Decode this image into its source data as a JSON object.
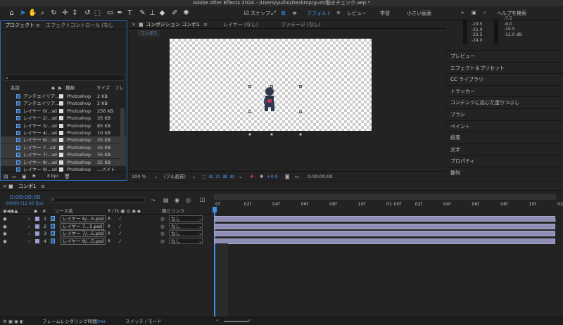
{
  "window_title": "Adobe After Effects 2024 - /Users/yuiho/Desktop/gust/動きチェック.aep *",
  "toolbar": {
    "snap_label": "スナップ",
    "workspaces": [
      "デフォルト",
      "レビュー",
      "学習",
      "小さい画面"
    ],
    "active_workspace": "デフォルト",
    "help_placeholder": "ヘルプを検索"
  },
  "project_panel": {
    "tabs": [
      "プロジェクト",
      "エフェクトコントロール (なし"
    ],
    "columns": {
      "name": "名前",
      "type": "種類",
      "size": "サイズ",
      "fr": "フレ"
    },
    "rows": [
      {
        "name": "アンチエイリア...",
        "type": "Photoshop",
        "size": "2 KB",
        "selected": false
      },
      {
        "name": "アンチエイリア...",
        "type": "Photoshop",
        "size": "2 KB",
        "selected": false
      },
      {
        "name": "レイヤー 0/...sd",
        "type": "Photoshop",
        "size": "256 KB",
        "selected": false
      },
      {
        "name": "レイヤー 2/...sd",
        "type": "Photoshop",
        "size": "35 KB",
        "selected": false
      },
      {
        "name": "レイヤー 3/...sd",
        "type": "Photoshop",
        "size": "85 KB",
        "selected": false
      },
      {
        "name": "レイヤー 4/...sd",
        "type": "Photoshop",
        "size": "10 KB",
        "selected": false
      },
      {
        "name": "レイヤー 6/...sd",
        "type": "Photoshop",
        "size": "35 KB",
        "selected": true
      },
      {
        "name": "レイヤー 7...sd",
        "type": "Photoshop",
        "size": "35 KB",
        "selected": true
      },
      {
        "name": "レイヤー 7/...sd",
        "type": "Photoshop",
        "size": "35 KB",
        "selected": true
      },
      {
        "name": "レイヤー 8/...sd",
        "type": "Photoshop",
        "size": "35 KB",
        "selected": true
      },
      {
        "name": "レイヤー 9/...sd",
        "type": "Photoshop",
        "size": "...バイト",
        "selected": false
      }
    ],
    "bpc": "8 bpc"
  },
  "comp_panel": {
    "tabs": [
      "コンポジション コンポ1",
      "レイヤー (なし)",
      "フッテージ (なし)"
    ],
    "breadcrumb": "コンポ1",
    "zoom": "100 %",
    "quality": "(フル画質)",
    "exposure": "+0.0",
    "timecode": "0:00:00:00"
  },
  "right_panel": {
    "meter_left": [
      "-19.5",
      "-21.0",
      "-22.5",
      "-24.0"
    ],
    "meter_right": [
      "-7.5",
      "-9.0",
      "-10.5",
      "-12.0 dB"
    ],
    "items": [
      "プレビュー",
      "エフェクト＆プリセット",
      "CC ライブラリ",
      "トラッカー",
      "コンテンツに応じた塗りつぶし",
      "ブラシ",
      "ペイント",
      "段落",
      "文字",
      "プロパティ",
      "整列"
    ]
  },
  "timeline": {
    "tab": "コンポ1",
    "timecode": "0:00:00:00",
    "fps": "00000 (12.00 fps)",
    "headers": {
      "source": "ソース名",
      "parent": "親とリンク"
    },
    "ruler": [
      "0f",
      "02f",
      "04f",
      "06f",
      "08f",
      "10f",
      "01:00f",
      "02f",
      "04f",
      "06f",
      "08f",
      "10f",
      "02"
    ],
    "layers": [
      {
        "num": "1",
        "name": "レイヤー 6/...5.psd",
        "parent": "なし"
      },
      {
        "num": "2",
        "name": "レイヤー 7...5.psd",
        "parent": "なし"
      },
      {
        "num": "3",
        "name": "レイヤー 7/...5.psd",
        "parent": "なし"
      },
      {
        "num": "4",
        "name": "レイヤー 8/...5.psd",
        "parent": "なし"
      }
    ]
  },
  "status_bar": {
    "render_label": "フレームレンダリング時間",
    "render_value": "0ms",
    "switch_mode": "スイッチ / モード"
  }
}
